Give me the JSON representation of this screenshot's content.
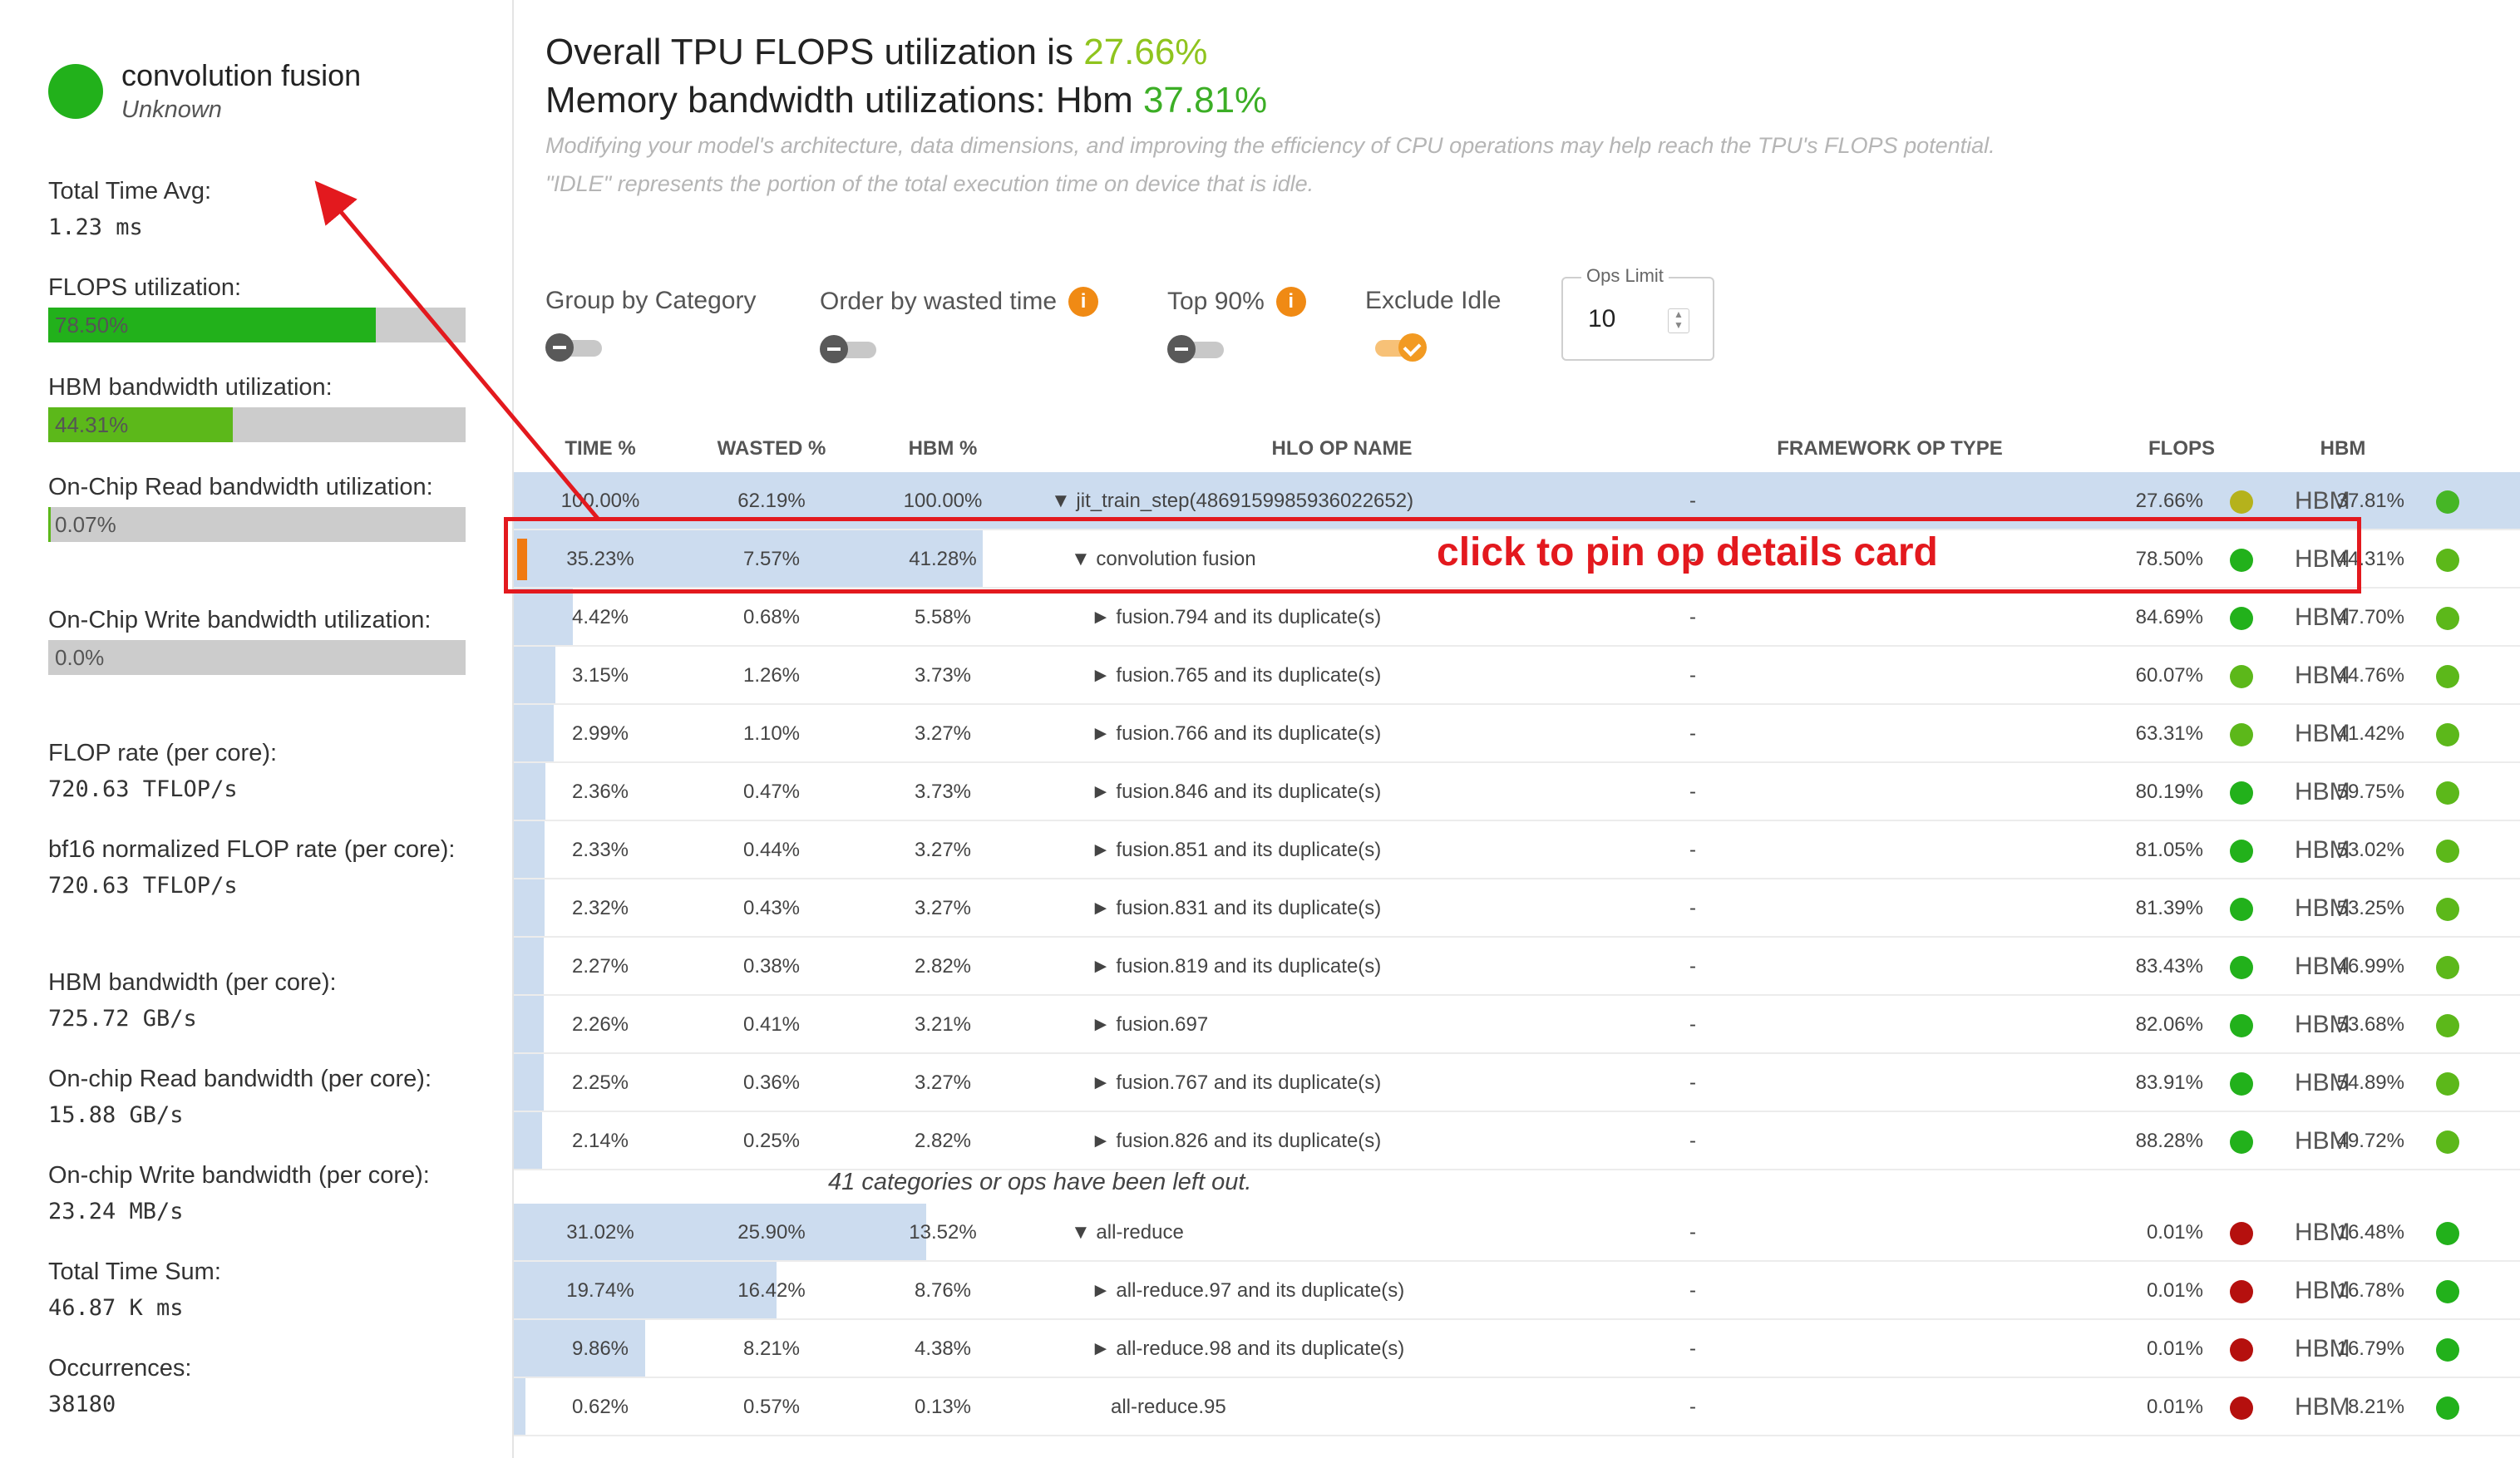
{
  "card": {
    "title": "convolution fusion",
    "subtitle": "Unknown",
    "dot_color": "#22b11b",
    "metrics": [
      {
        "label": "Total Time Avg:",
        "value": "1.23 ms"
      },
      {
        "label": "FLOPS utilization:",
        "bar_text": "78.50%",
        "bar_fraction": 0.785,
        "bar_color": "#22b11b"
      },
      {
        "label": "HBM bandwidth utilization:",
        "bar_text": "44.31%",
        "bar_fraction": 0.4431,
        "bar_color": "#5cb81a"
      },
      {
        "label": "On-Chip Read bandwidth utilization:",
        "bar_text": "0.07%",
        "bar_fraction": 0.0007,
        "bar_color": "#5cb81a"
      },
      {
        "label": "On-Chip Write bandwidth utilization:",
        "bar_text": "0.0%",
        "bar_fraction": 0.0,
        "bar_color": "#5cb81a"
      },
      {
        "label": "FLOP rate (per core):",
        "value": "720.63 TFLOP/s"
      },
      {
        "label": "bf16 normalized FLOP rate (per core):",
        "value": "720.63 TFLOP/s"
      },
      {
        "label": "HBM bandwidth (per core):",
        "value": "725.72 GB/s"
      },
      {
        "label": "On-chip Read bandwidth (per core):",
        "value": "15.88 GB/s"
      },
      {
        "label": "On-chip Write bandwidth (per core):",
        "value": "23.24 MB/s"
      },
      {
        "label": "Total Time Sum:",
        "value": "46.87 K ms"
      },
      {
        "label": "Occurrences:",
        "value": "38180"
      }
    ]
  },
  "header": {
    "line1_prefix": "Overall TPU FLOPS utilization is ",
    "line1_value": "27.66%",
    "line2_prefix": "Memory bandwidth utilizations: Hbm ",
    "line2_value": "37.81%",
    "note1": "Modifying your model's architecture, data dimensions, and improving the efficiency of CPU operations may help reach the TPU's FLOPS potential.",
    "note2": "\"IDLE\" represents the portion of the total execution time on device that is idle."
  },
  "controls": {
    "group_by": "Group by Category",
    "order_by": "Order by wasted time",
    "top90": "Top 90%",
    "exclude_idle": "Exclude Idle",
    "ops_limit_label": "Ops Limit",
    "ops_limit_value": "10",
    "info_glyph": "i"
  },
  "table": {
    "headers": [
      "TIME %",
      "WASTED %",
      "HBM %",
      "HLO OP NAME",
      "FRAMEWORK OP TYPE",
      "FLOPS",
      "HBM"
    ],
    "hbm_label": "HBM",
    "rows": [
      {
        "time": "100.00%",
        "time_frac": 1.0,
        "wasted": "62.19%",
        "hbm_pct": "100.00%",
        "name": "▼  jit_train_step(4869159985936022652)",
        "indent": 0,
        "fw": "-",
        "flops": "27.66%",
        "flops_color": "#b5b21c",
        "hbm": "37.81%",
        "hbm_color": "#46b626",
        "root": true
      },
      {
        "time": "35.23%",
        "time_frac": 0.3523,
        "wasted": "7.57%",
        "hbm_pct": "41.28%",
        "name": "▼  convolution fusion",
        "indent": 1,
        "fw": "-",
        "flops": "78.50%",
        "flops_color": "#22b11b",
        "hbm": "44.31%",
        "hbm_color": "#5cb81a",
        "pinned": true
      },
      {
        "time": "4.42%",
        "time_frac": 0.0442,
        "wasted": "0.68%",
        "hbm_pct": "5.58%",
        "name": "►  fusion.794 and its duplicate(s)",
        "indent": 2,
        "fw": "-",
        "flops": "84.69%",
        "flops_color": "#22b11b",
        "hbm": "47.70%",
        "hbm_color": "#5cb81a"
      },
      {
        "time": "3.15%",
        "time_frac": 0.0315,
        "wasted": "1.26%",
        "hbm_pct": "3.73%",
        "name": "►  fusion.765 and its duplicate(s)",
        "indent": 2,
        "fw": "-",
        "flops": "60.07%",
        "flops_color": "#5cb81a",
        "hbm": "44.76%",
        "hbm_color": "#5cb81a"
      },
      {
        "time": "2.99%",
        "time_frac": 0.0299,
        "wasted": "1.10%",
        "hbm_pct": "3.27%",
        "name": "►  fusion.766 and its duplicate(s)",
        "indent": 2,
        "fw": "-",
        "flops": "63.31%",
        "flops_color": "#5cb81a",
        "hbm": "41.42%",
        "hbm_color": "#5cb81a"
      },
      {
        "time": "2.36%",
        "time_frac": 0.0236,
        "wasted": "0.47%",
        "hbm_pct": "3.73%",
        "name": "►  fusion.846 and its duplicate(s)",
        "indent": 2,
        "fw": "-",
        "flops": "80.19%",
        "flops_color": "#22b11b",
        "hbm": "59.75%",
        "hbm_color": "#5cb81a"
      },
      {
        "time": "2.33%",
        "time_frac": 0.0233,
        "wasted": "0.44%",
        "hbm_pct": "3.27%",
        "name": "►  fusion.851 and its duplicate(s)",
        "indent": 2,
        "fw": "-",
        "flops": "81.05%",
        "flops_color": "#22b11b",
        "hbm": "53.02%",
        "hbm_color": "#5cb81a"
      },
      {
        "time": "2.32%",
        "time_frac": 0.0232,
        "wasted": "0.43%",
        "hbm_pct": "3.27%",
        "name": "►  fusion.831 and its duplicate(s)",
        "indent": 2,
        "fw": "-",
        "flops": "81.39%",
        "flops_color": "#22b11b",
        "hbm": "53.25%",
        "hbm_color": "#5cb81a"
      },
      {
        "time": "2.27%",
        "time_frac": 0.0227,
        "wasted": "0.38%",
        "hbm_pct": "2.82%",
        "name": "►  fusion.819 and its duplicate(s)",
        "indent": 2,
        "fw": "-",
        "flops": "83.43%",
        "flops_color": "#22b11b",
        "hbm": "46.99%",
        "hbm_color": "#5cb81a"
      },
      {
        "time": "2.26%",
        "time_frac": 0.0226,
        "wasted": "0.41%",
        "hbm_pct": "3.21%",
        "name": "►  fusion.697",
        "indent": 2,
        "fw": "-",
        "flops": "82.06%",
        "flops_color": "#22b11b",
        "hbm": "53.68%",
        "hbm_color": "#5cb81a"
      },
      {
        "time": "2.25%",
        "time_frac": 0.0225,
        "wasted": "0.36%",
        "hbm_pct": "3.27%",
        "name": "►  fusion.767 and its duplicate(s)",
        "indent": 2,
        "fw": "-",
        "flops": "83.91%",
        "flops_color": "#22b11b",
        "hbm": "54.89%",
        "hbm_color": "#5cb81a"
      },
      {
        "time": "2.14%",
        "time_frac": 0.0214,
        "wasted": "0.25%",
        "hbm_pct": "2.82%",
        "name": "►  fusion.826 and its duplicate(s)",
        "indent": 2,
        "fw": "-",
        "flops": "88.28%",
        "flops_color": "#22b11b",
        "hbm": "49.72%",
        "hbm_color": "#5cb81a"
      },
      {
        "time": "31.02%",
        "time_frac": 0.3102,
        "wasted": "25.90%",
        "hbm_pct": "13.52%",
        "name": "▼  all-reduce",
        "indent": 1,
        "fw": "-",
        "flops": "0.01%",
        "flops_color": "#b5100e",
        "hbm": "16.48%",
        "hbm_color": "#22b11b"
      },
      {
        "time": "19.74%",
        "time_frac": 0.1974,
        "wasted": "16.42%",
        "hbm_pct": "8.76%",
        "name": "►  all-reduce.97 and its duplicate(s)",
        "indent": 2,
        "fw": "-",
        "flops": "0.01%",
        "flops_color": "#b5100e",
        "hbm": "16.78%",
        "hbm_color": "#22b11b"
      },
      {
        "time": "9.86%",
        "time_frac": 0.0986,
        "wasted": "8.21%",
        "hbm_pct": "4.38%",
        "name": "►  all-reduce.98 and its duplicate(s)",
        "indent": 2,
        "fw": "-",
        "flops": "0.01%",
        "flops_color": "#b5100e",
        "hbm": "16.79%",
        "hbm_color": "#22b11b"
      },
      {
        "time": "0.62%",
        "time_frac": 0.0062,
        "wasted": "0.57%",
        "hbm_pct": "0.13%",
        "name": "all-reduce.95",
        "indent": 2,
        "fw": "-",
        "flops": "0.01%",
        "flops_color": "#b5100e",
        "hbm": "8.21%",
        "hbm_color": "#22b11b"
      }
    ],
    "left_out_note": "41 categories or ops have been left out."
  },
  "annotation": {
    "text": "click to pin op details card",
    "color": "#e3191e"
  }
}
